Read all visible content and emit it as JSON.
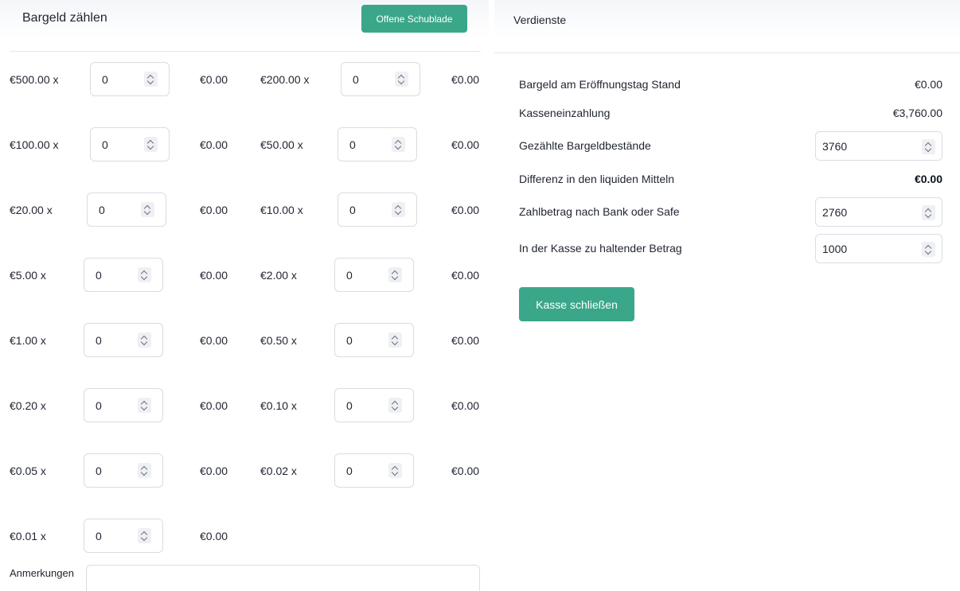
{
  "left": {
    "title": "Bargeld zählen",
    "open_drawer_label": "Offene Schublade",
    "denominations": [
      {
        "label": "€500.00 x",
        "qty": "0",
        "total": "€0.00"
      },
      {
        "label": "€200.00 x",
        "qty": "0",
        "total": "€0.00"
      },
      {
        "label": "€100.00 x",
        "qty": "0",
        "total": "€0.00"
      },
      {
        "label": "€50.00 x",
        "qty": "0",
        "total": "€0.00"
      },
      {
        "label": "€20.00 x",
        "qty": "0",
        "total": "€0.00"
      },
      {
        "label": "€10.00 x",
        "qty": "0",
        "total": "€0.00"
      },
      {
        "label": "€5.00 x",
        "qty": "0",
        "total": "€0.00"
      },
      {
        "label": "€2.00 x",
        "qty": "0",
        "total": "€0.00"
      },
      {
        "label": "€1.00 x",
        "qty": "0",
        "total": "€0.00"
      },
      {
        "label": "€0.50 x",
        "qty": "0",
        "total": "€0.00"
      },
      {
        "label": "€0.20 x",
        "qty": "0",
        "total": "€0.00"
      },
      {
        "label": "€0.10 x",
        "qty": "0",
        "total": "€0.00"
      },
      {
        "label": "€0.05 x",
        "qty": "0",
        "total": "€0.00"
      },
      {
        "label": "€0.02 x",
        "qty": "0",
        "total": "€0.00"
      },
      {
        "label": "€0.01 x",
        "qty": "0",
        "total": "€0.00"
      }
    ],
    "notes_label": "Anmerkungen",
    "notes_value": ""
  },
  "right": {
    "title": "Verdienste",
    "opening_cash_label": "Bargeld am Eröffnungstag Stand",
    "opening_cash_value": "€0.00",
    "cash_payment_label": "Kasseneinzahlung",
    "cash_payment_value": "€3,760.00",
    "counted_cash_label": "Gezählte Bargeldbestände",
    "counted_cash_value": "3760",
    "difference_label": "Differenz in den liquiden Mitteln",
    "difference_value": "€0.00",
    "bank_transfer_label": "Zahlbetrag nach Bank oder Safe",
    "bank_transfer_value": "2760",
    "keep_in_drawer_label": "In der Kasse zu haltender Betrag",
    "keep_in_drawer_value": "1000",
    "close_register_label": "Kasse schließen"
  },
  "colors": {
    "accent": "#3aa68a",
    "border": "#d9dce2",
    "text": "#1f2430"
  },
  "icons": [
    "spinner-arrows-icon"
  ]
}
